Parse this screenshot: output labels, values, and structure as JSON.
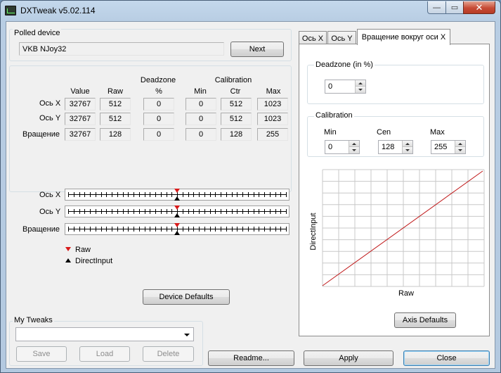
{
  "window": {
    "title": "DXTweak v5.02.114",
    "minimize_glyph": "—",
    "maximize_glyph": "▭",
    "close_glyph": "✕"
  },
  "polled_device": {
    "label": "Polled device",
    "value": "VKB NJoy32",
    "next_label": "Next"
  },
  "table": {
    "headers": {
      "value": "Value",
      "raw": "Raw",
      "deadzone_top": "Deadzone",
      "deadzone_pct": "%",
      "calibration": "Calibration",
      "min": "Min",
      "ctr": "Ctr",
      "max": "Max"
    },
    "rows": [
      {
        "name": "Ось X",
        "value": "32767",
        "raw": "512",
        "deadzone": "0",
        "min": "0",
        "ctr": "512",
        "max": "1023"
      },
      {
        "name": "Ось Y",
        "value": "32767",
        "raw": "512",
        "deadzone": "0",
        "min": "0",
        "ctr": "512",
        "max": "1023"
      },
      {
        "name": "Вращение",
        "value": "32767",
        "raw": "128",
        "deadzone": "0",
        "min": "0",
        "ctr": "128",
        "max": "255"
      }
    ]
  },
  "sliders": [
    {
      "name": "Ось X",
      "raw_position": 0.5,
      "directinput_position": 0.5
    },
    {
      "name": "Ось Y",
      "raw_position": 0.5,
      "directinput_position": 0.5
    },
    {
      "name": "Вращение",
      "raw_position": 0.5,
      "directinput_position": 0.5
    }
  ],
  "legend": {
    "raw": "Raw",
    "directinput": "DirectInput",
    "raw_color": "#d81a1a",
    "directinput_color": "#000000"
  },
  "device_defaults_label": "Device Defaults",
  "my_tweaks": {
    "label": "My Tweaks",
    "selected": "",
    "save_label": "Save",
    "load_label": "Load",
    "delete_label": "Delete"
  },
  "tabs": [
    {
      "label": "Ось X",
      "active": false
    },
    {
      "label": "Ось Y",
      "active": false
    },
    {
      "label": "Вращение вокруг оси X",
      "active": true
    }
  ],
  "axis_panel": {
    "deadzone_label": "Deadzone (in %)",
    "deadzone_value": "0",
    "calibration_label": "Calibration",
    "min_label": "Min",
    "cen_label": "Cen",
    "max_label": "Max",
    "min_value": "0",
    "cen_value": "128",
    "max_value": "255",
    "graph_xlabel": "Raw",
    "graph_ylabel": "DirectInput",
    "line_color": "#c0191a",
    "axis_defaults_label": "Axis Defaults"
  },
  "bottom_buttons": {
    "readme": "Readme...",
    "apply": "Apply",
    "close": "Close"
  }
}
